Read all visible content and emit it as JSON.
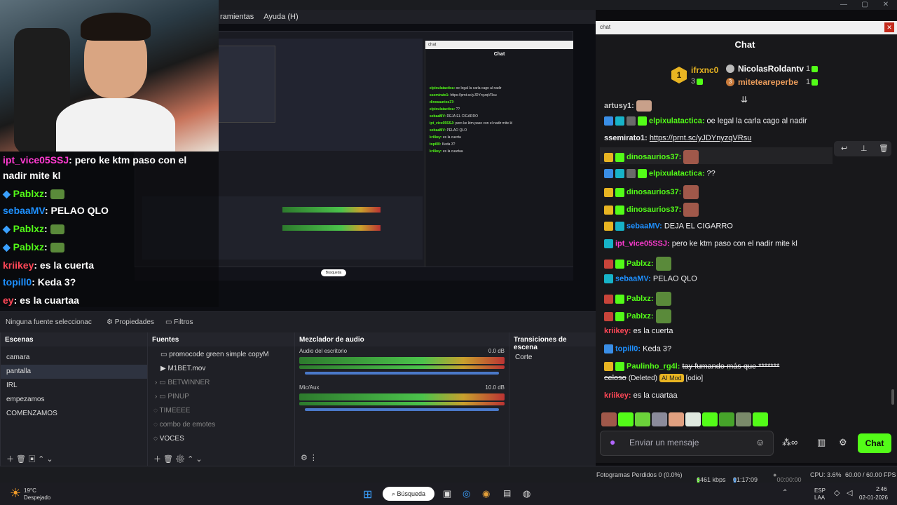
{
  "window_title": "chat",
  "obs_menu": {
    "items": [
      "ramientas",
      "Ayuda (H)"
    ]
  },
  "chat": {
    "title": "Chat",
    "leaderboard": [
      {
        "rank": "1",
        "name": "ifrxnc0",
        "count": "3"
      },
      {
        "name": "NicolasRoldantv",
        "count": "1"
      },
      {
        "rank": "3",
        "name": "miteteareperbe",
        "count": "1"
      }
    ],
    "messages": [
      {
        "user": "artusy1:",
        "text": "",
        "user_color": "#c9c9c9"
      },
      {
        "user": "elpixulatactica:",
        "text": "oe legal la carla cago al nadir",
        "user_color": "#53fc18"
      },
      {
        "user": "ssemirato1:",
        "text": "https://prnt.sc/yJDYnyzqVRsu",
        "user_color": "#efeff1"
      },
      {
        "user": "dinosaurios37:",
        "text": "",
        "user_color": "#53fc18"
      },
      {
        "user": "elpixulatactica:",
        "text": "??",
        "user_color": "#53fc18"
      },
      {
        "user": "dinosaurios37:",
        "text": "",
        "user_color": "#53fc18"
      },
      {
        "user": "dinosaurios37:",
        "text": "",
        "user_color": "#53fc18"
      },
      {
        "user": "sebaaMV:",
        "text": "DEJA EL CIGARRO",
        "user_color": "#1e90ff"
      },
      {
        "user": "ipt_vice05SSJ:",
        "text": "pero ke ktm paso con el nadir mite kl",
        "user_color": "#ff3bd1"
      },
      {
        "user": "Pablxz:",
        "text": "",
        "user_color": "#53fc18"
      },
      {
        "user": "sebaaMV:",
        "text": "PELAO QLO",
        "user_color": "#1e90ff"
      },
      {
        "user": "Pablxz:",
        "text": "",
        "user_color": "#53fc18"
      },
      {
        "user": "Pablxz:",
        "text": "",
        "user_color": "#53fc18"
      },
      {
        "user": "kriikey:",
        "text": "es la cuerta",
        "user_color": "#ff4757"
      },
      {
        "user": "topill0:",
        "text": "Keda 3?",
        "user_color": "#1e90ff"
      },
      {
        "user": "Paulinho_rg4l:",
        "text": "tay fumando más que *******",
        "user_color": "#53fc18"
      },
      {
        "user": "kriikey:",
        "text": "es la cuartaa",
        "user_color": "#ff4757"
      }
    ],
    "deleted_line": {
      "word": "celoso",
      "deleted": "(Deleted)",
      "mod": "AI Mod",
      "reason": "[odio]"
    },
    "input_placeholder": "Enviar un mensaje",
    "send_label": "Chat"
  },
  "overlay_chat": [
    {
      "user": "ipt_vice05SSJ",
      "text": ": pero ke ktm paso con el",
      "color": "#ff3bd1"
    },
    {
      "user": "",
      "text": "nadir mite kl",
      "color": "#ffffff"
    },
    {
      "user": "Pablxz",
      "text": ":",
      "color": "#53fc18"
    },
    {
      "user": "sebaaMV",
      "text": ": PELAO QLO",
      "color": "#1e90ff"
    },
    {
      "user": "Pablxz",
      "text": ":",
      "color": "#53fc18"
    },
    {
      "user": "Pablxz",
      "text": ":",
      "color": "#53fc18"
    },
    {
      "user": "kriikey",
      "text": ": es la cuerta",
      "color": "#ff4757"
    },
    {
      "user": "topill0",
      "text": ": Keda 3?",
      "color": "#1e90ff"
    },
    {
      "user": "ey",
      "text": ": es la cuartaa",
      "color": "#ff4757"
    }
  ],
  "source_bar": {
    "no_source": "Ninguna fuente seleccionac",
    "properties": "Propiedades",
    "filters": "Filtros"
  },
  "scenes": {
    "title": "Escenas",
    "items": [
      "camara",
      "pantalla",
      "IRL",
      "empezamos",
      "COMENZAMOS"
    ],
    "selected": "pantalla"
  },
  "sources": {
    "title": "Fuentes",
    "items": [
      "promocode green simple copyM",
      "M1BET.mov",
      "BETWINNER",
      "PINUP",
      "TIMEEEE",
      "combo de emotes",
      "VOCES"
    ]
  },
  "mixer": {
    "title": "Mezclador de audio",
    "channels": [
      {
        "name": "Audio del escritorio",
        "db": "0.0 dB"
      },
      {
        "name": "Mic/Aux",
        "db": "10.0 dB"
      }
    ],
    "scale": [
      "-60",
      "-55",
      "-50",
      "-45",
      "-40",
      "-35",
      "-30",
      "-25",
      "-20",
      "-15",
      "-10",
      "-5",
      "0"
    ]
  },
  "transitions": {
    "title": "Transiciones de escena",
    "value": "Corte"
  },
  "status": {
    "dropped": "Fotogramas Perdidos 0 (0.0%)",
    "bitrate": "6461 kbps",
    "live_time": "01:17:09",
    "rec_time": "00:00:00",
    "cpu": "CPU: 3.6%",
    "fps": "60.00 / 60.00 FPS"
  },
  "taskbar": {
    "weather_temp": "19°C",
    "weather_desc": "Despejado",
    "search": "Búsqueda",
    "lang1": "ESP",
    "lang2": "LAA",
    "time": "2:46",
    "date": "02-01-2026"
  },
  "colors": {
    "kick_green": "#53fc18",
    "bg": "#18181b",
    "gold": "#e8b422"
  }
}
